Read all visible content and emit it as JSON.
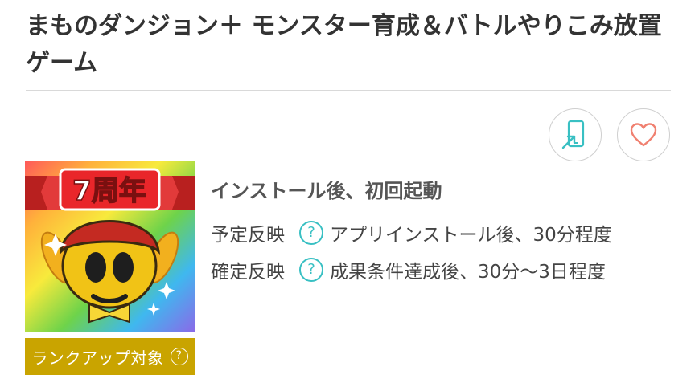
{
  "app": {
    "title": "まものダンジョン＋ モンスター育成＆バトルやりこみ放置ゲーム",
    "icon_label": "7周年"
  },
  "actions": {
    "device_icon": "send-to-device-icon",
    "favorite_icon": "heart-icon",
    "accent_color": "#39c0c3",
    "heart_color": "#f08070"
  },
  "condition": {
    "heading": "インストール後、初回起動",
    "rows": [
      {
        "label": "予定反映",
        "help": "?",
        "value": "アプリインストール後、30分程度"
      },
      {
        "label": "確定反映",
        "help": "?",
        "value": "成果条件達成後、30分〜3日程度"
      }
    ]
  },
  "rank_badge": {
    "label": "ランクアップ対象",
    "help": "?",
    "color": "#c9a400"
  }
}
